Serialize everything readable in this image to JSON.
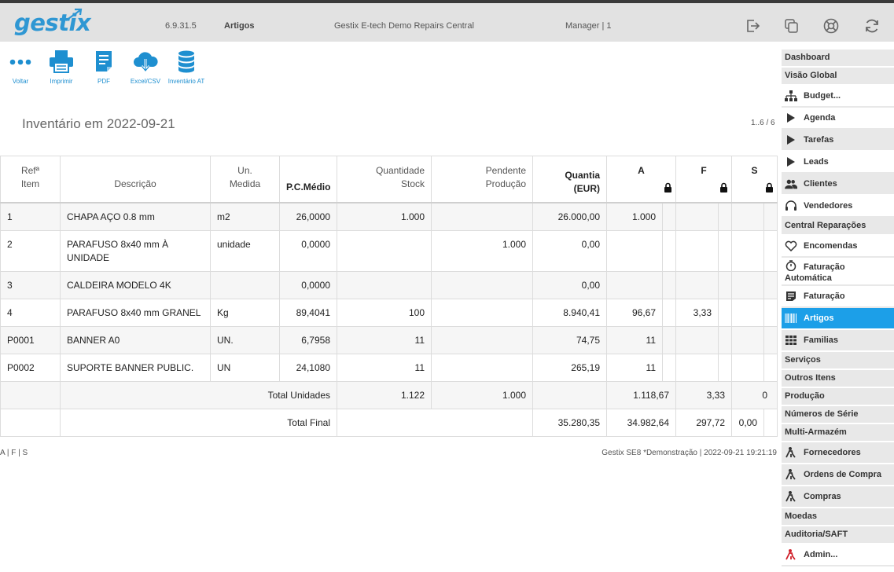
{
  "header": {
    "logo": "gestix",
    "version": "6.9.31.5",
    "module": "Artigos",
    "company": "Gestix E-tech Demo Repairs Central",
    "user": "Manager | 1",
    "icons": [
      "logout-icon",
      "windows-icon",
      "help-lifebuoy-icon",
      "refresh-icon"
    ]
  },
  "toolbar": {
    "back": "Voltar",
    "print": "Imprimir",
    "pdf": "PDF",
    "excel": "Excel/CSV",
    "inventory_at": "Inventário AT"
  },
  "page": {
    "title": "Inventário em 2022-09-21",
    "pager": "1..6 / 6"
  },
  "table": {
    "headers": {
      "ref_line1": "Refª",
      "ref_line2": "Item",
      "desc": "Descrição",
      "unit_line1": "Un.",
      "unit_line2": "Medida",
      "avg_price": "P.C.Médio",
      "qty_line1": "Quantidade",
      "qty_line2": "Stock",
      "pend_line1": "Pendente",
      "pend_line2": "Produção",
      "amount_line1": "Quantia",
      "amount_line2": "(EUR)",
      "a": "A",
      "f": "F",
      "s": "S"
    },
    "rows": [
      {
        "ref": "1",
        "desc": "CHAPA AÇO 0.8 mm",
        "unit": "m2",
        "price": "26,0000",
        "qty": "1.000",
        "pend": "",
        "amount": "26.000,00",
        "a": "1.000",
        "f": "",
        "s": ""
      },
      {
        "ref": "2",
        "desc": "PARAFUSO 8x40 mm À UNIDADE",
        "unit": "unidade",
        "price": "0,0000",
        "qty": "",
        "pend": "1.000",
        "amount": "0,00",
        "a": "",
        "f": "",
        "s": ""
      },
      {
        "ref": "3",
        "desc": "CALDEIRA MODELO 4K",
        "unit": "",
        "price": "0,0000",
        "qty": "",
        "pend": "",
        "amount": "0,00",
        "a": "",
        "f": "",
        "s": ""
      },
      {
        "ref": "4",
        "desc": "PARAFUSO 8x40 mm GRANEL",
        "unit": "Kg",
        "price": "89,4041",
        "qty": "100",
        "pend": "",
        "amount": "8.940,41",
        "a": "96,67",
        "f": "3,33",
        "s": ""
      },
      {
        "ref": "P0001",
        "desc": "BANNER A0",
        "unit": "UN.",
        "price": "6,7958",
        "qty": "11",
        "pend": "",
        "amount": "74,75",
        "a": "11",
        "f": "",
        "s": ""
      },
      {
        "ref": "P0002",
        "desc": "SUPORTE BANNER PUBLIC.",
        "unit": "UN",
        "price": "24,1080",
        "qty": "11",
        "pend": "",
        "amount": "265,19",
        "a": "11",
        "f": "",
        "s": ""
      }
    ],
    "total_units": {
      "label": "Total Unidades",
      "qty": "1.122",
      "pend": "1.000",
      "amount": "",
      "a": "1.118,67",
      "f": "3,33",
      "s": "0"
    },
    "total_final": {
      "label": "Total Final",
      "amount": "35.280,35",
      "a": "34.982,64",
      "f": "297,72",
      "s": "0,00"
    }
  },
  "footer": {
    "legend": "A | F | S",
    "info": "Gestix SE8 *Demonstração | 2022-09-21 19:21:19"
  },
  "sidebar": {
    "dashboard": "Dashboard",
    "global": "Visão Global",
    "budget": "Budget...",
    "agenda": "Agenda",
    "tarefas": "Tarefas",
    "leads": "Leads",
    "clientes": "Clientes",
    "vendedores": "Vendedores",
    "central": "Central Reparações",
    "encomendas": "Encomendas",
    "fat_auto_1": "Faturação",
    "fat_auto_2": "Automática",
    "faturacao": "Faturação",
    "artigos": "Artigos",
    "familias": "Familias",
    "servicos": "Serviços",
    "outros": "Outros Itens",
    "producao": "Produção",
    "series": "Números de Série",
    "multi": "Multi-Armazém",
    "fornecedores": "Fornecedores",
    "ordens": "Ordens de Compra",
    "compras": "Compras",
    "moedas": "Moedas",
    "auditoria": "Auditoria/SAFT",
    "admin": "Admin..."
  },
  "colors": {
    "accent": "#1c9fe8",
    "logo": "#2f97d3",
    "header_bg": "#e2e2e2"
  }
}
